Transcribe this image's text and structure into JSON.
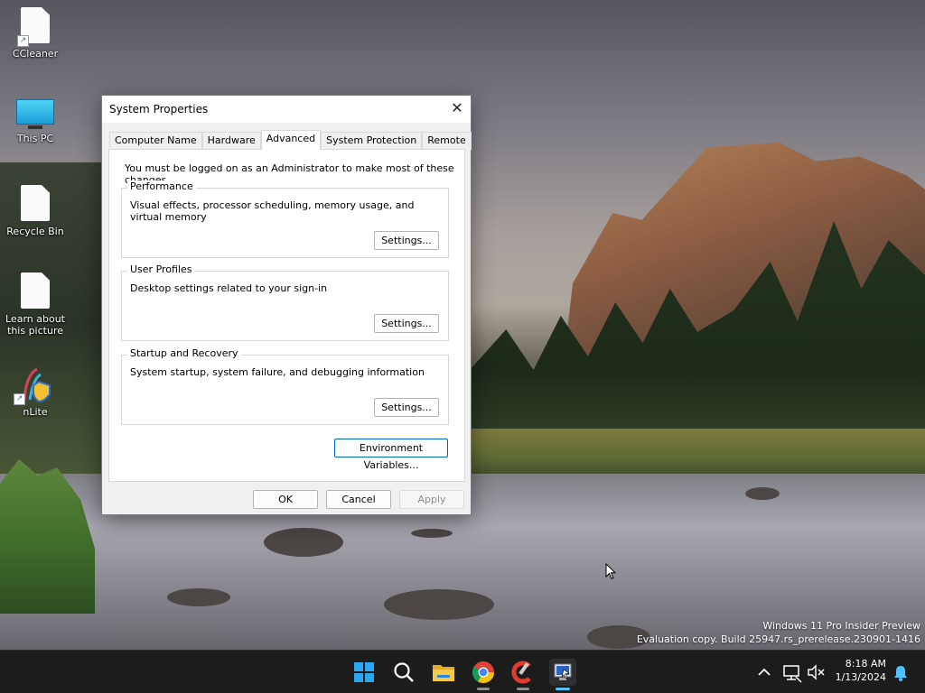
{
  "desktop": {
    "icons": [
      {
        "label": "CCleaner",
        "icon": "document-shortcut-icon"
      },
      {
        "label": "This PC",
        "icon": "monitor-icon"
      },
      {
        "label": "Recycle Bin",
        "icon": "recycle-bin-icon"
      },
      {
        "label": "Learn about this picture",
        "icon": "document-icon"
      },
      {
        "label": "nLite",
        "icon": "nlite-shortcut-icon"
      }
    ]
  },
  "dialog": {
    "title": "System Properties",
    "close_glyph": "✕",
    "tabs": [
      {
        "label": "Computer Name",
        "active": false
      },
      {
        "label": "Hardware",
        "active": false
      },
      {
        "label": "Advanced",
        "active": true
      },
      {
        "label": "System Protection",
        "active": false
      },
      {
        "label": "Remote",
        "active": false
      }
    ],
    "notice": "You must be logged on as an Administrator to make most of these changes.",
    "groups": [
      {
        "title": "Performance",
        "description": "Visual effects, processor scheduling, memory usage, and virtual memory",
        "button": "Settings..."
      },
      {
        "title": "User Profiles",
        "description": "Desktop settings related to your sign-in",
        "button": "Settings..."
      },
      {
        "title": "Startup and Recovery",
        "description": "System startup, system failure, and debugging information",
        "button": "Settings..."
      }
    ],
    "env_button": "Environment Variables...",
    "ok_button": "OK",
    "cancel_button": "Cancel",
    "apply_button": "Apply"
  },
  "watermark": {
    "line1": "Windows 11 Pro Insider Preview",
    "line2": "Evaluation copy. Build 25947.rs_prerelease.230901-1416"
  },
  "taskbar": {
    "icons": [
      "windows-start-icon",
      "search-icon",
      "file-explorer-icon",
      "chrome-icon",
      "ccleaner-icon",
      "system-properties-icon"
    ],
    "tray": {
      "time": "8:18 AM",
      "date": "1/13/2024"
    }
  },
  "colors": {
    "accent": "#0067c0",
    "taskbar": "#1c1c1c",
    "dialog_bg": "#f0f0f0"
  }
}
